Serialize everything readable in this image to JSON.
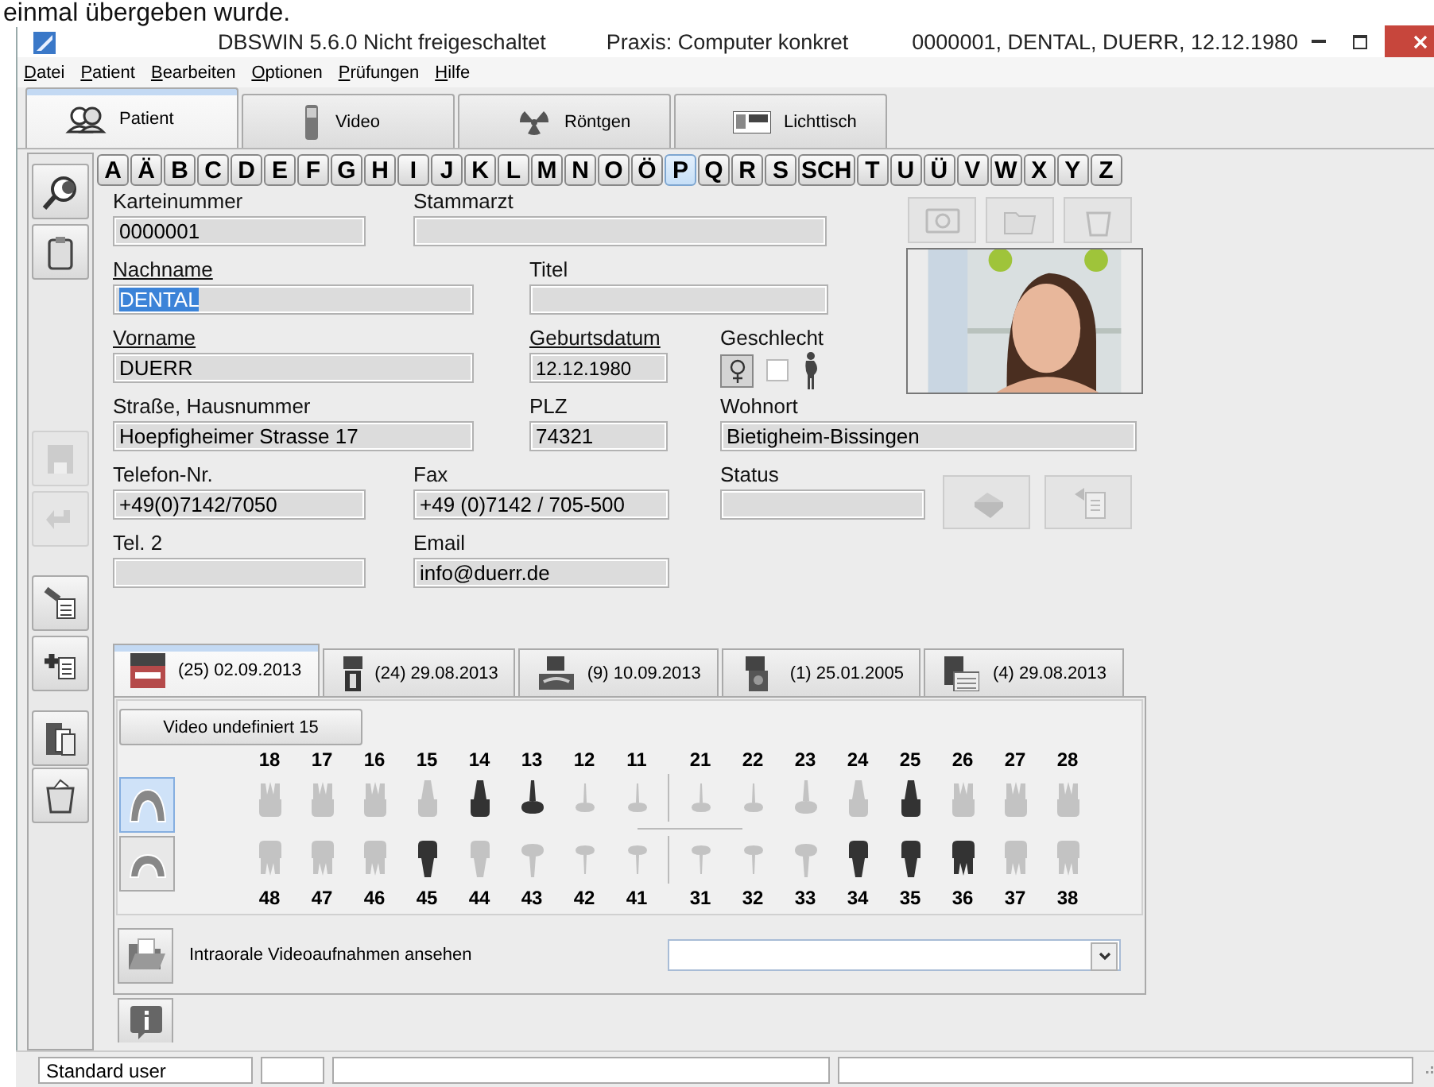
{
  "caption": "einmal übergeben wurde.",
  "window": {
    "title_parts": [
      "DBSWIN 5.6.0 Nicht freigeschaltet",
      "Praxis: Computer konkret",
      "0000001, DENTAL, DUERR, 12.12.1980"
    ]
  },
  "menu": [
    "Datei",
    "Patient",
    "Bearbeiten",
    "Optionen",
    "Prüfungen",
    "Hilfe"
  ],
  "tabs": [
    {
      "label": "Patient",
      "selected": true
    },
    {
      "label": "Video",
      "selected": false
    },
    {
      "label": "Röntgen",
      "selected": false
    },
    {
      "label": "Lichttisch",
      "selected": false
    }
  ],
  "toolbar": [
    {
      "disabled": false
    },
    {
      "disabled": false
    },
    {
      "disabled": true
    },
    {
      "disabled": true
    },
    {
      "disabled": false
    },
    {
      "disabled": false
    },
    {
      "disabled": false
    },
    {
      "disabled": false
    }
  ],
  "alphabet": [
    {
      "label": "A",
      "selected": false
    },
    {
      "label": "Ä",
      "selected": false
    },
    {
      "label": "B",
      "selected": false
    },
    {
      "label": "C",
      "selected": false
    },
    {
      "label": "D",
      "selected": false
    },
    {
      "label": "E",
      "selected": false
    },
    {
      "label": "F",
      "selected": false
    },
    {
      "label": "G",
      "selected": false
    },
    {
      "label": "H",
      "selected": false
    },
    {
      "label": "I",
      "selected": false
    },
    {
      "label": "J",
      "selected": false
    },
    {
      "label": "K",
      "selected": false
    },
    {
      "label": "L",
      "selected": false
    },
    {
      "label": "M",
      "selected": false
    },
    {
      "label": "N",
      "selected": false
    },
    {
      "label": "O",
      "selected": false
    },
    {
      "label": "Ö",
      "selected": false
    },
    {
      "label": "P",
      "selected": true
    },
    {
      "label": "Q",
      "selected": false
    },
    {
      "label": "R",
      "selected": false
    },
    {
      "label": "S",
      "selected": false
    },
    {
      "label": "SCH",
      "selected": false
    },
    {
      "label": "T",
      "selected": false
    },
    {
      "label": "U",
      "selected": false
    },
    {
      "label": "Ü",
      "selected": false
    },
    {
      "label": "V",
      "selected": false
    },
    {
      "label": "W",
      "selected": false
    },
    {
      "label": "X",
      "selected": false
    },
    {
      "label": "Y",
      "selected": false
    },
    {
      "label": "Z",
      "selected": false
    }
  ],
  "fields": [
    {
      "label": "Karteinummer",
      "value": "0000001",
      "required": false,
      "highlighted": false
    },
    {
      "label": "Stammarzt",
      "required": false
    },
    {
      "label": "Nachname",
      "value": "DENTAL",
      "required": true,
      "highlighted": true
    },
    {
      "label": "Titel",
      "required": false
    },
    {
      "label": "Vorname",
      "value": "DUERR",
      "required": true,
      "highlighted": false
    },
    {
      "label": "Geburtsdatum",
      "value": "12.12.1980",
      "required": true,
      "highlighted": false
    },
    {
      "label": "Straße, Hausnummer",
      "value": "Hoepfigheimer Strasse 17",
      "required": false,
      "highlighted": false
    },
    {
      "label": "PLZ",
      "value": "74321",
      "required": false,
      "highlighted": false
    },
    {
      "label": "Wohnort",
      "value": "Bietigheim-Bissingen",
      "required": false,
      "highlighted": false
    },
    {
      "label": "Telefon-Nr.",
      "value": "+49(0)7142/7050",
      "required": false,
      "highlighted": false
    },
    {
      "label": "Fax",
      "value": "+49 (0)7142 / 705-500",
      "required": false,
      "highlighted": false
    },
    {
      "label": "Status",
      "required": false
    },
    {
      "label": "Tel. 2",
      "required": false
    },
    {
      "label": "Email",
      "value": "info@duerr.de",
      "required": false,
      "highlighted": false
    }
  ],
  "gender": {
    "label": "Geschlecht",
    "female_selected": true,
    "pregnant_checked": false
  },
  "photo_buttons": [
    {
      "disabled": true
    },
    {
      "disabled": true
    },
    {
      "disabled": true
    }
  ],
  "status_buttons": [
    {
      "disabled": true
    },
    {
      "disabled": true
    }
  ],
  "image_tabs": [
    {
      "label": "(25) 02.09.2013",
      "selected": true
    },
    {
      "label": "(24) 29.08.2013",
      "selected": false
    },
    {
      "label": "(9) 10.09.2013",
      "selected": false
    },
    {
      "label": "(1) 25.01.2005",
      "selected": false
    },
    {
      "label": "(4) 29.08.2013",
      "selected": false
    }
  ],
  "video_button": "Video undefiniert 15",
  "jaw_buttons": [
    {
      "selected": true
    },
    {
      "selected": false
    }
  ],
  "upper_teeth": [
    {
      "number": "18",
      "kind": "molar",
      "marked": false
    },
    {
      "number": "17",
      "kind": "molar",
      "marked": false
    },
    {
      "number": "16",
      "kind": "molar",
      "marked": false
    },
    {
      "number": "15",
      "kind": "premolar",
      "marked": false
    },
    {
      "number": "14",
      "kind": "premolar",
      "marked": true
    },
    {
      "number": "13",
      "kind": "canine",
      "marked": true
    },
    {
      "number": "12",
      "kind": "incisor",
      "marked": false
    },
    {
      "number": "11",
      "kind": "incisor",
      "marked": false
    },
    {
      "number": "21",
      "kind": "incisor",
      "marked": false
    },
    {
      "number": "22",
      "kind": "incisor",
      "marked": false
    },
    {
      "number": "23",
      "kind": "canine",
      "marked": false
    },
    {
      "number": "24",
      "kind": "premolar",
      "marked": false
    },
    {
      "number": "25",
      "kind": "premolar",
      "marked": true
    },
    {
      "number": "26",
      "kind": "molar",
      "marked": false
    },
    {
      "number": "27",
      "kind": "molar",
      "marked": false
    },
    {
      "number": "28",
      "kind": "molar",
      "marked": false
    }
  ],
  "lower_teeth": [
    {
      "number": "48",
      "kind": "molar",
      "marked": false
    },
    {
      "number": "47",
      "kind": "molar",
      "marked": false
    },
    {
      "number": "46",
      "kind": "molar",
      "marked": false
    },
    {
      "number": "45",
      "kind": "premolar",
      "marked": true
    },
    {
      "number": "44",
      "kind": "premolar",
      "marked": false
    },
    {
      "number": "43",
      "kind": "canine",
      "marked": false
    },
    {
      "number": "42",
      "kind": "incisor",
      "marked": false
    },
    {
      "number": "41",
      "kind": "incisor",
      "marked": false
    },
    {
      "number": "31",
      "kind": "incisor",
      "marked": false
    },
    {
      "number": "32",
      "kind": "incisor",
      "marked": false
    },
    {
      "number": "33",
      "kind": "canine",
      "marked": false
    },
    {
      "number": "34",
      "kind": "premolar",
      "marked": true
    },
    {
      "number": "35",
      "kind": "premolar",
      "marked": true
    },
    {
      "number": "36",
      "kind": "molar",
      "marked": true
    },
    {
      "number": "37",
      "kind": "molar",
      "marked": false
    },
    {
      "number": "38",
      "kind": "molar",
      "marked": false
    }
  ],
  "video_row": {
    "label": "Intraorale Videoaufnahmen ansehen"
  },
  "status_bar": [
    "Standard user"
  ]
}
